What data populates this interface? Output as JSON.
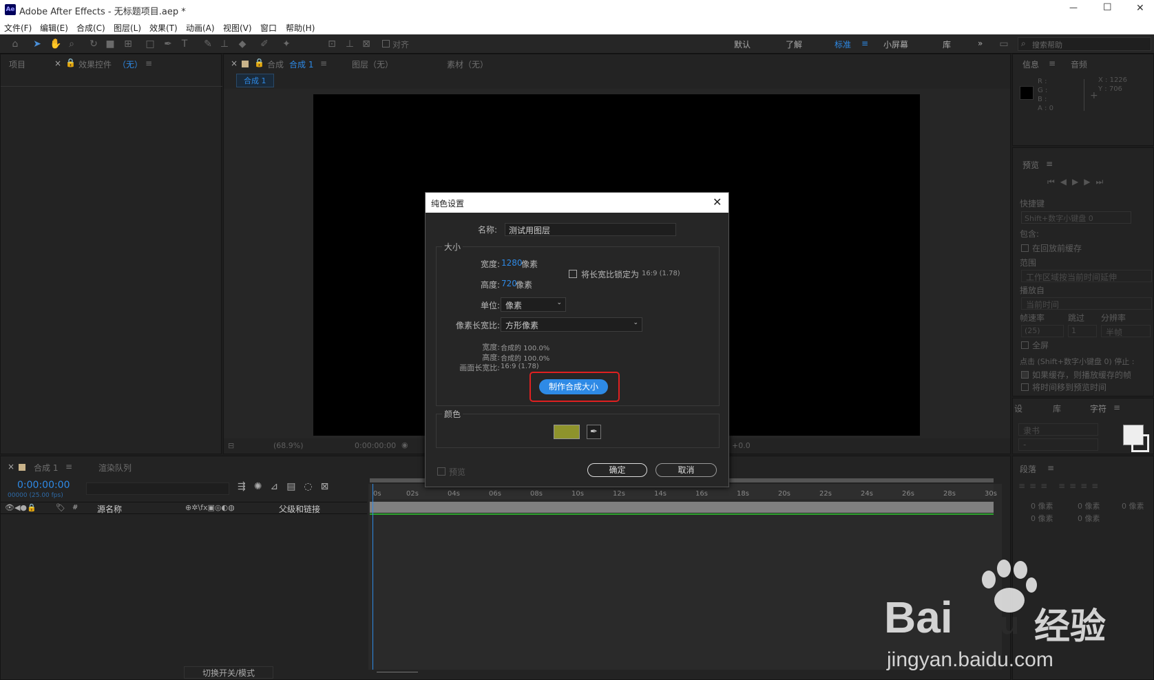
{
  "window": {
    "app_icon": "Ae",
    "title": "Adobe After Effects - 无标题项目.aep *",
    "minimize": "—",
    "maximize": "☐",
    "close": "✕"
  },
  "menu": [
    "文件(F)",
    "编辑(E)",
    "合成(C)",
    "图层(L)",
    "效果(T)",
    "动画(A)",
    "视图(V)",
    "窗口",
    "帮助(H)"
  ],
  "toolbar": {
    "align_label": "对齐",
    "workspaces": [
      "默认",
      "了解",
      "标准",
      "小屏幕",
      "库"
    ],
    "search_placeholder": "搜索帮助",
    "more": "»"
  },
  "left_panel": {
    "tab_project": "项目",
    "tab_effects": "效果控件",
    "tab_effects_value": "（无）"
  },
  "center": {
    "tab_comp": "合成",
    "tab_comp_name": "合成 1",
    "tab_layer": "图层（无）",
    "tab_footage": "素材（无）",
    "comp_flow": "合成 1",
    "zoom": "(68.9%)",
    "timecode": "0:00:00:00",
    "offset": "+0.0"
  },
  "info": {
    "tab_info": "信息",
    "tab_audio": "音频",
    "r": "R :",
    "g": "G :",
    "b": "B :",
    "a": "A : 0",
    "x": "X : 1226",
    "y": "Y : 706"
  },
  "preview": {
    "tab": "预览",
    "shortcut_label": "快捷键",
    "shortcut_value": "Shift+数字小键盘 0",
    "include_label": "包含:",
    "cache_before": "在回放前缓存",
    "range_label": "范围",
    "range_value": "工作区域按当前时间延伸",
    "play_from_label": "播放自",
    "play_from_value": "当前时间",
    "framerate_label": "帧速率",
    "skip_label": "跳过",
    "resolution_label": "分辨率",
    "framerate_value": "(25)",
    "skip_value": "1",
    "resolution_value": "半帧",
    "fullscreen": "全屏",
    "stop_note": "点击 (Shift+数字小键盘 0) 停止 :",
    "cache_note": "如果缓存，则播放缓存的帧",
    "move_time": "将时间移到预览时间"
  },
  "char_panel": {
    "tab_settings": "设",
    "tab_library": "库",
    "tab_char": "字符",
    "font": "隶书",
    "style": "-"
  },
  "para_panel": {
    "tab": "段落",
    "indent1": "0 像素",
    "indent2": "0 像素",
    "indent3": "0 像素",
    "space1": "0 像素",
    "space2": "0 像素"
  },
  "timeline": {
    "tab_comp": "合成 1",
    "tab_render": "渲染队列",
    "timecode": "0:00:00:00",
    "frames": "00000 (25.00 fps)",
    "col_num": "#",
    "col_source": "源名称",
    "col_parent": "父级和链接",
    "toggle_label": "切换开关/模式",
    "ticks": [
      "0s",
      "02s",
      "04s",
      "06s",
      "08s",
      "10s",
      "12s",
      "14s",
      "16s",
      "18s",
      "20s",
      "22s",
      "24s",
      "26s",
      "28s",
      "30s"
    ]
  },
  "dialog": {
    "title": "纯色设置",
    "name_label": "名称:",
    "name_value": "测试用图层",
    "size_group": "大小",
    "width_label": "宽度:",
    "width_value": "1280",
    "width_unit": "像素",
    "height_label": "高度:",
    "height_value": "720",
    "height_unit": "像素",
    "lock_aspect": "将长宽比锁定为",
    "lock_ratio": "16:9 (1.78)",
    "units_label": "单位:",
    "units_value": "像素",
    "par_label": "像素长宽比:",
    "par_value": "方形像素",
    "pct_width_label": "宽度:",
    "pct_width_value": "合成的 100.0%",
    "pct_height_label": "高度:",
    "pct_height_value": "合成的 100.0%",
    "frame_aspect_label": "画面长宽比:",
    "frame_aspect_value": "16:9 (1.78)",
    "make_comp_size": "制作合成大小",
    "color_group": "颜色",
    "color_swatch": "#8e932c",
    "preview_label": "预览",
    "ok": "确定",
    "cancel": "取消"
  },
  "watermark": {
    "brand": "Bai",
    "brand2": "du",
    "cn": "经验",
    "url": "jingyan.baidu.com"
  },
  "colors": {
    "accent": "#2e8ae6",
    "highlight_box": "#e02020",
    "swatch": "#8e932c",
    "bg": "#1d1d1d"
  }
}
